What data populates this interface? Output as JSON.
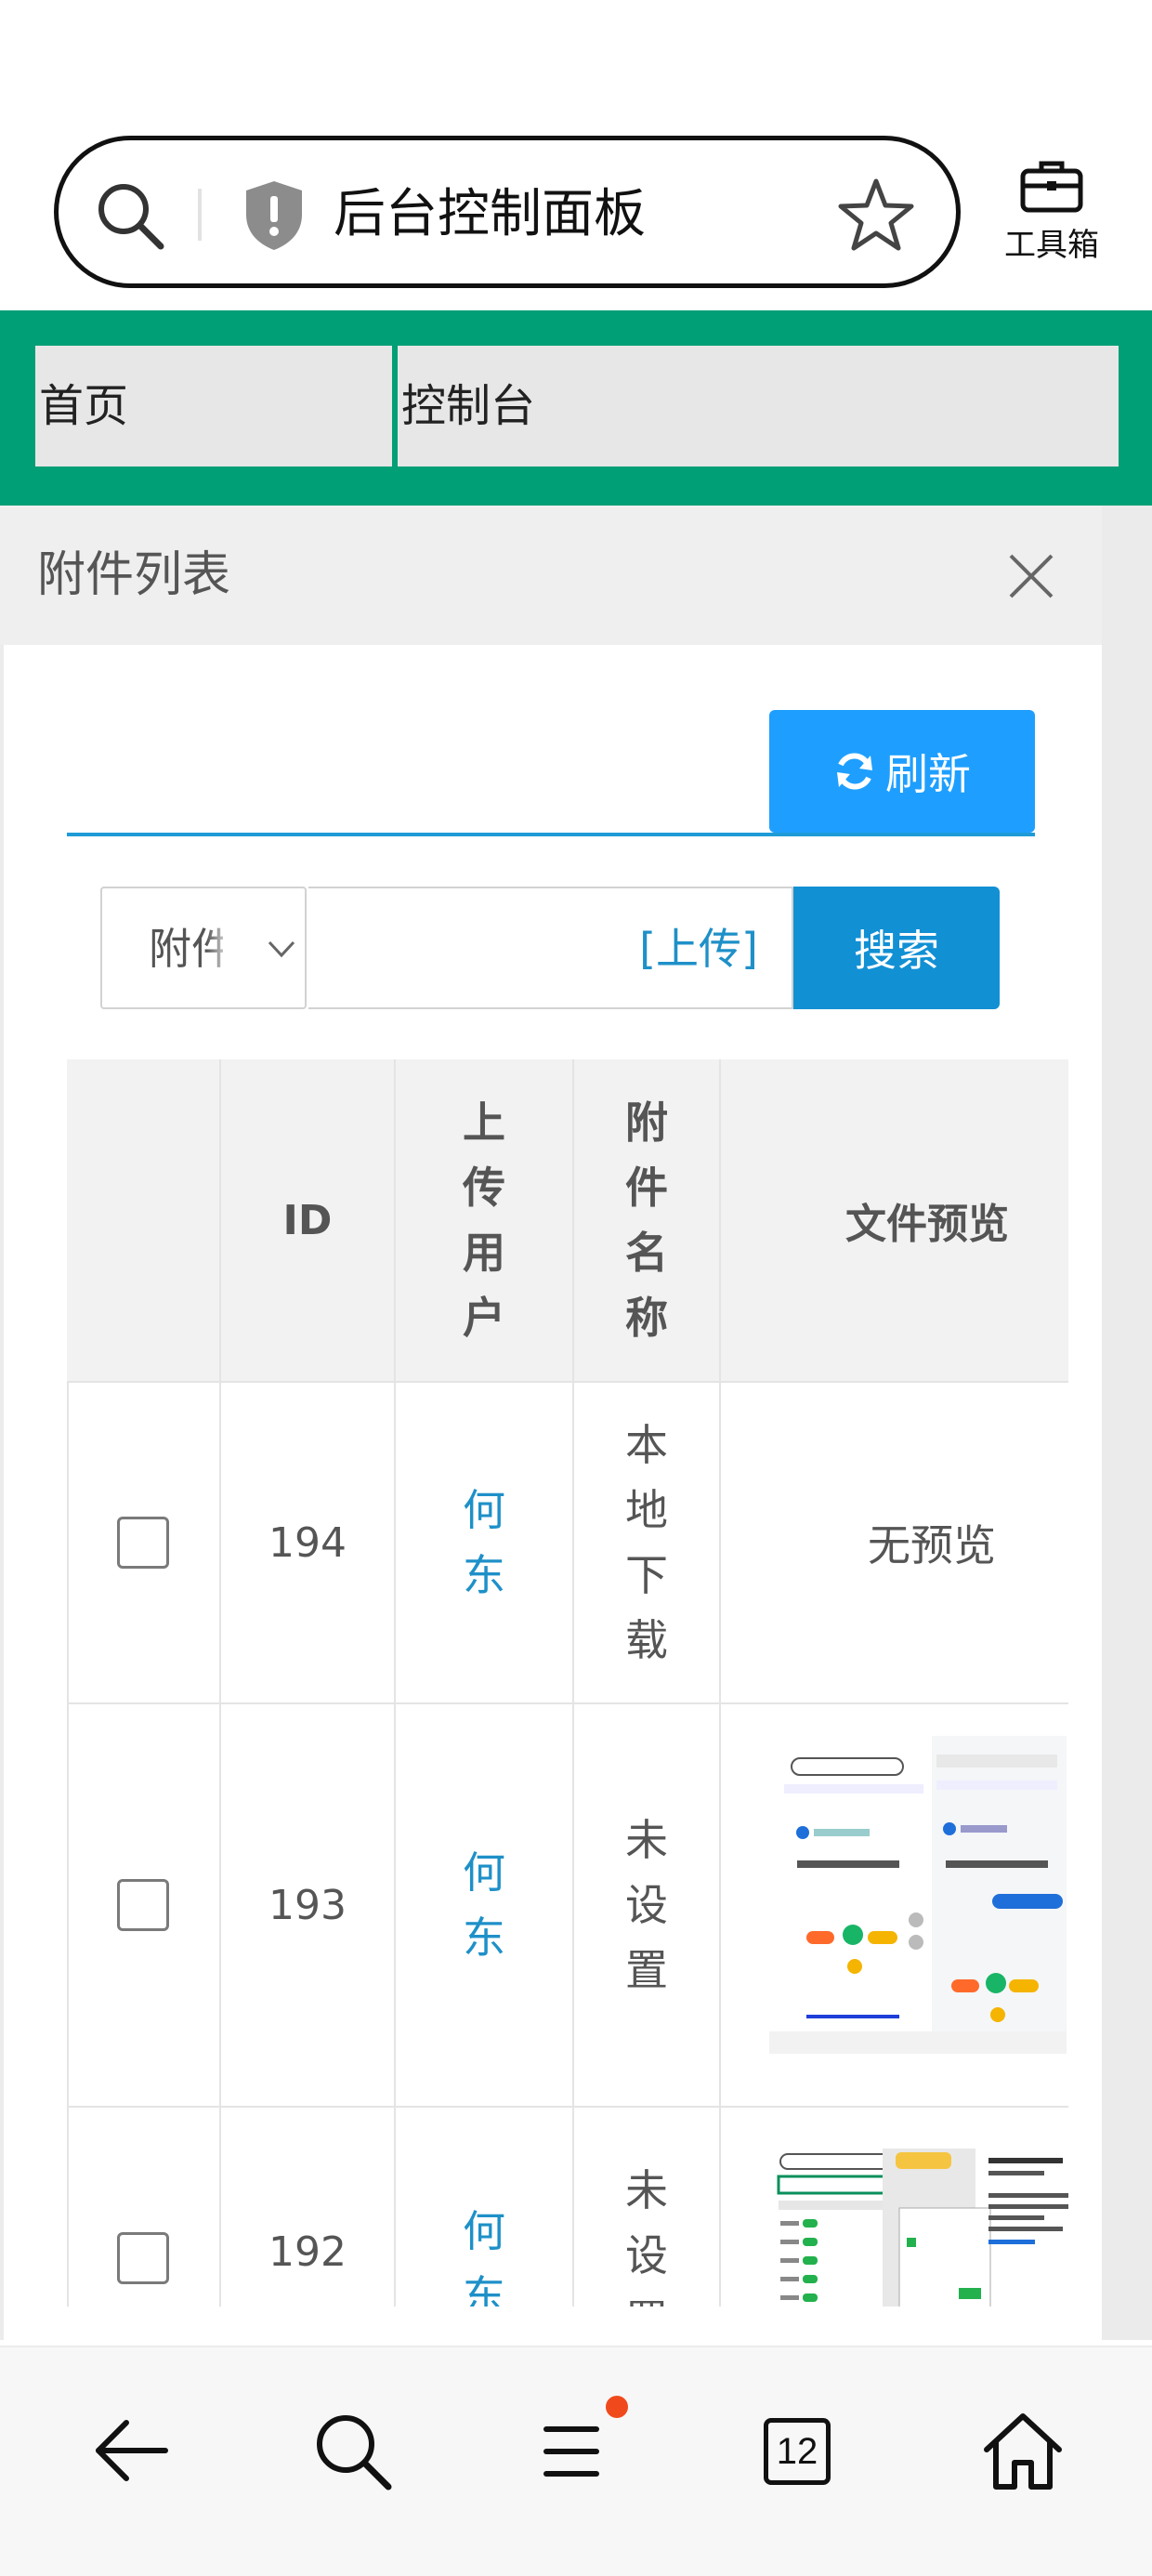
{
  "browser": {
    "address_title": "后台控制面板",
    "toolbox_label": "工具箱"
  },
  "tabs": [
    {
      "label": "首页"
    },
    {
      "label": "控制台"
    }
  ],
  "panel": {
    "title": "附件列表",
    "refresh_label": "刷新",
    "filter_select_value": "附件",
    "upload_link": "[上传]",
    "search_label": "搜索"
  },
  "table": {
    "headers": {
      "id": "ID",
      "user": "上传用户",
      "name": "附件名称",
      "preview": "文件预览"
    },
    "rows": [
      {
        "id": "194",
        "user": "何东",
        "name": "本地下载",
        "preview": "无预览"
      },
      {
        "id": "193",
        "user": "何东",
        "name": "未设置",
        "preview": ""
      },
      {
        "id": "192",
        "user": "何东",
        "name": "未设置",
        "preview": ""
      }
    ]
  },
  "bottom_nav": {
    "tab_count": "12"
  },
  "colors": {
    "brand_green": "#009f76",
    "primary_blue": "#1e9fff",
    "search_blue": "#1290d4",
    "link_blue": "#1e90c8",
    "notify_red": "#f04a1c"
  }
}
